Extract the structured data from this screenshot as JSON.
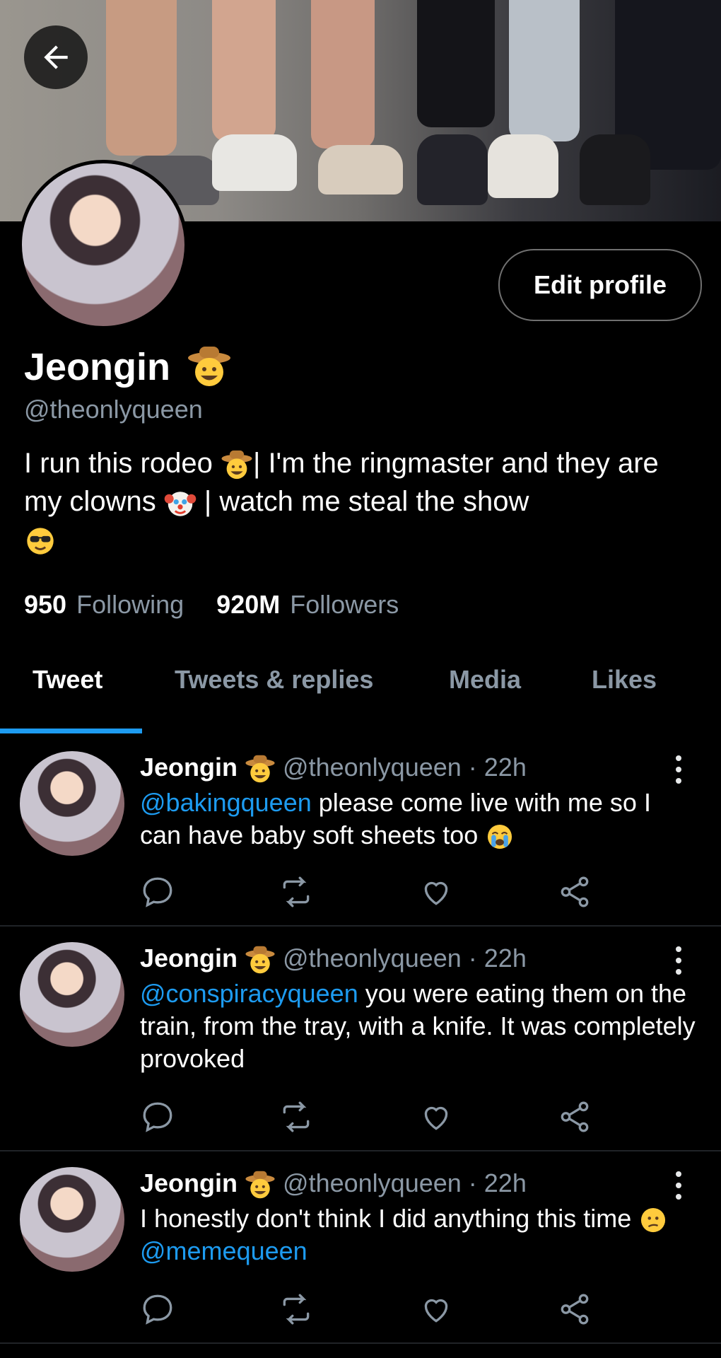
{
  "profile": {
    "name": "Jeongin",
    "handle": "@theonlyqueen",
    "bio_part1": "I run this rodeo ",
    "bio_part2": "| I'm the ringmaster and they are my clowns ",
    "bio_part3": " | watch me steal the show",
    "edit_label": "Edit profile",
    "following_count": "950",
    "following_label": "Following",
    "followers_count": "920M",
    "followers_label": "Followers"
  },
  "tabs": [
    "Tweet",
    "Tweets & replies",
    "Media",
    "Likes"
  ],
  "tweets": [
    {
      "name": "Jeongin",
      "meta": "@theonlyqueen · 22h",
      "mention": "@bakingqueen",
      "text": " please come live with me so I can have baby soft sheets too "
    },
    {
      "name": "Jeongin",
      "meta": "@theonlyqueen · 22h",
      "mention": "@conspiracyqueen",
      "text": " you were eating them on the train, from the tray, with a knife. It was completely provoked"
    },
    {
      "name": "Jeongin",
      "meta": "@theonlyqueen · 22h",
      "text": "I honestly don't think I did anything this time ",
      "mention": "@memequeen"
    }
  ],
  "icons": {
    "back": "arrow-left-icon",
    "cowboy": "cowboy-emoji",
    "clown": "clown-emoji",
    "cool": "sunglasses-emoji",
    "cry": "crying-emoji",
    "confused": "confused-emoji",
    "reply": "reply-icon",
    "retweet": "retweet-icon",
    "like": "heart-icon",
    "share": "share-icon",
    "more": "more-vertical-icon"
  },
  "colors": {
    "accent": "#1d9bf0",
    "muted": "#8b98a5"
  }
}
